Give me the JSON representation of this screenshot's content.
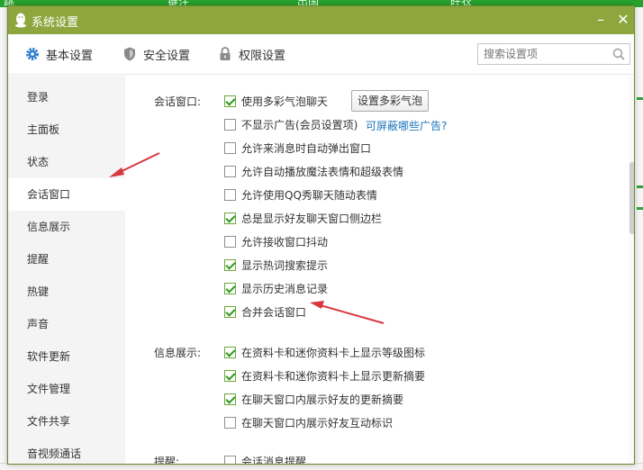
{
  "dialog": {
    "title": "系统设置",
    "minimize_glyph": "–",
    "close_glyph": "✕"
  },
  "tabs": [
    {
      "label": "基本设置",
      "icon": "gear-icon",
      "active": true
    },
    {
      "label": "安全设置",
      "icon": "shield-icon",
      "active": false
    },
    {
      "label": "权限设置",
      "icon": "lock-icon",
      "active": false
    }
  ],
  "search": {
    "placeholder": "搜索设置项"
  },
  "sidebar": {
    "items": [
      {
        "label": "登录"
      },
      {
        "label": "主面板"
      },
      {
        "label": "状态"
      },
      {
        "label": "会话窗口",
        "active": true
      },
      {
        "label": "信息展示"
      },
      {
        "label": "提醒"
      },
      {
        "label": "热键"
      },
      {
        "label": "声音"
      },
      {
        "label": "软件更新"
      },
      {
        "label": "文件管理"
      },
      {
        "label": "文件共享"
      },
      {
        "label": "音视频通话"
      }
    ]
  },
  "sections": {
    "chat_window": {
      "label": "会话窗口:",
      "bubble_button": "设置多彩气泡",
      "ad_link": "可屏蔽哪些广告?",
      "options": [
        {
          "label": "使用多彩气泡聊天",
          "checked": true
        },
        {
          "label": "不显示广告(会员设置项)",
          "checked": false
        },
        {
          "label": "允许来消息时自动弹出窗口",
          "checked": false
        },
        {
          "label": "允许自动播放魔法表情和超级表情",
          "checked": false
        },
        {
          "label": "允许使用QQ秀聊天随动表情",
          "checked": false
        },
        {
          "label": "总是显示好友聊天窗口侧边栏",
          "checked": true
        },
        {
          "label": "允许接收窗口抖动",
          "checked": false
        },
        {
          "label": "显示热词搜索提示",
          "checked": true
        },
        {
          "label": "显示历史消息记录",
          "checked": true
        },
        {
          "label": "合并会话窗口",
          "checked": true
        }
      ]
    },
    "info_display": {
      "label": "信息展示:",
      "options": [
        {
          "label": "在资料卡和迷你资料卡上显示等级图标",
          "checked": true
        },
        {
          "label": "在资料卡和迷你资料卡上显示更新摘要",
          "checked": true
        },
        {
          "label": "在聊天窗口内展示好友的更新摘要",
          "checked": true
        },
        {
          "label": "在聊天窗口内展示好友互动标识",
          "checked": false
        }
      ]
    },
    "reminder": {
      "label": "提醒:",
      "options": [
        {
          "label": "会话消息提醒",
          "checked": false
        }
      ]
    }
  },
  "background": {
    "top_strip_texts": [
      "跳",
      "键注",
      "出国",
      "旺衣"
    ]
  },
  "colors": {
    "titlebar": "#8da63e",
    "accent_green": "#2f9a1e",
    "link_blue": "#1a75bb",
    "annotation_red": "#d9363e"
  }
}
